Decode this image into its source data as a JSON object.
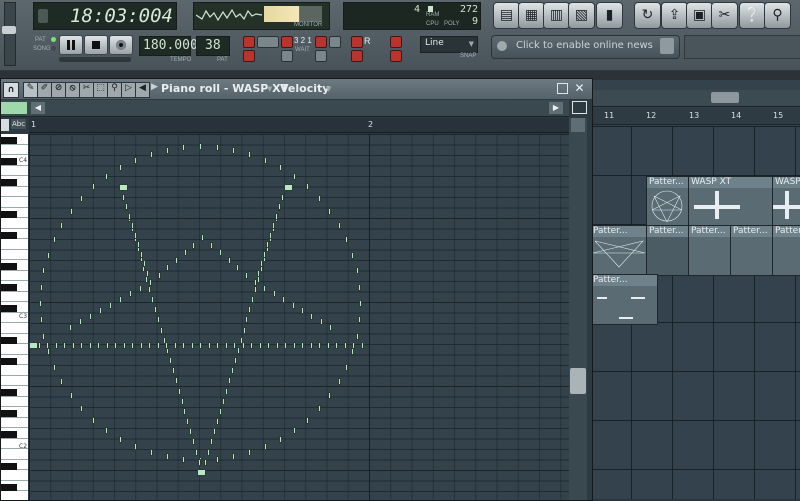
{
  "toolbar": {
    "time": "18:03:004",
    "pat_label": "PAT",
    "song_label": "SONG",
    "tempo": "180.000",
    "tempo_label": "TEMPO",
    "pattern_num": "38",
    "pattern_label": "PAT",
    "monitor_label": "MONITOR",
    "cpu_label": "CPU",
    "poly_label": "POLY",
    "ram_label": "RAM",
    "cpu_value": "4",
    "poly_value": "9",
    "ram_value": "272",
    "snap_value": "Line",
    "snap_label": "SNAP",
    "news_text": "Click to enable online news",
    "wait_label": "WAIT",
    "rec_label": "R"
  },
  "pianoroll": {
    "title": "Piano roll - WASP XT",
    "param": "Velocity",
    "abc": "Abc",
    "bar1": "1",
    "bar2": "2",
    "key_labels": [
      "C4",
      "C3",
      "C2"
    ]
  },
  "playlist": {
    "bars": [
      "11",
      "12",
      "13",
      "14",
      "15"
    ],
    "clip_wasp": "WASP XT",
    "clip_pattern": "Patter..."
  },
  "colors": {
    "note": "#b9e6c6",
    "grid": "#33424b",
    "toolbar": "#525d64"
  },
  "icons": [
    "play-icon",
    "stop-icon",
    "record-icon",
    "piano-icon",
    "mixer-icon",
    "browser-icon",
    "playlist-icon",
    "channel-icon",
    "undo-icon",
    "save-icon",
    "cut-icon",
    "help-icon",
    "search-icon"
  ]
}
